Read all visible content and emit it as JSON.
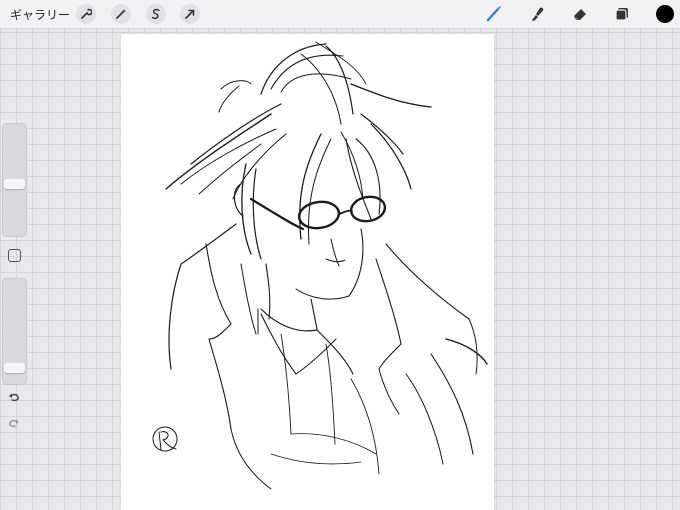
{
  "topbar": {
    "gallery_label": "ギャラリー",
    "left_tools": [
      "wrench-icon",
      "magic-wand-icon",
      "selection-s-icon",
      "transform-arrow-icon"
    ],
    "right_tools": [
      "brush-icon",
      "smudge-icon",
      "eraser-icon",
      "layers-icon"
    ],
    "active_tool": "brush-icon",
    "active_color": "#000000",
    "accent_color": "#2f7cf6"
  },
  "sidebar": {
    "brush_size_level": 0.45,
    "opacity_level": 0.1,
    "controls": [
      "modify-button",
      "undo-icon",
      "redo-icon"
    ]
  },
  "canvas": {
    "background": "#ffffff",
    "artwork": "sketch-illustration",
    "signature": "handwritten-signature"
  }
}
